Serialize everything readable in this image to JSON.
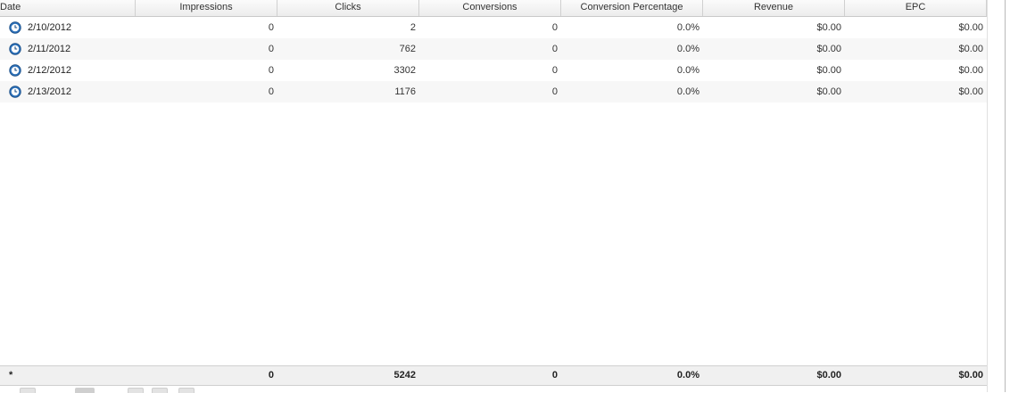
{
  "columns": {
    "date": "Date",
    "impressions": "Impressions",
    "clicks": "Clicks",
    "conversions": "Conversions",
    "conversion_percentage": "Conversion Percentage",
    "revenue": "Revenue",
    "epc": "EPC"
  },
  "rows": [
    {
      "date": "2/10/2012",
      "impressions": "0",
      "clicks": "2",
      "conversions": "0",
      "conversion_percentage": "0.0%",
      "revenue": "$0.00",
      "epc": "$0.00"
    },
    {
      "date": "2/11/2012",
      "impressions": "0",
      "clicks": "762",
      "conversions": "0",
      "conversion_percentage": "0.0%",
      "revenue": "$0.00",
      "epc": "$0.00"
    },
    {
      "date": "2/12/2012",
      "impressions": "0",
      "clicks": "3302",
      "conversions": "0",
      "conversion_percentage": "0.0%",
      "revenue": "$0.00",
      "epc": "$0.00"
    },
    {
      "date": "2/13/2012",
      "impressions": "0",
      "clicks": "1176",
      "conversions": "0",
      "conversion_percentage": "0.0%",
      "revenue": "$0.00",
      "epc": "$0.00"
    }
  ],
  "totals": {
    "label": "*",
    "impressions": "0",
    "clicks": "5242",
    "conversions": "0",
    "conversion_percentage": "0.0%",
    "revenue": "$0.00",
    "epc": "$0.00"
  },
  "row_icon": "clock-icon",
  "colors": {
    "icon_blue": "#2a6fb8",
    "header_bg": "#ececec",
    "alt_row": "#f7f7f7"
  }
}
